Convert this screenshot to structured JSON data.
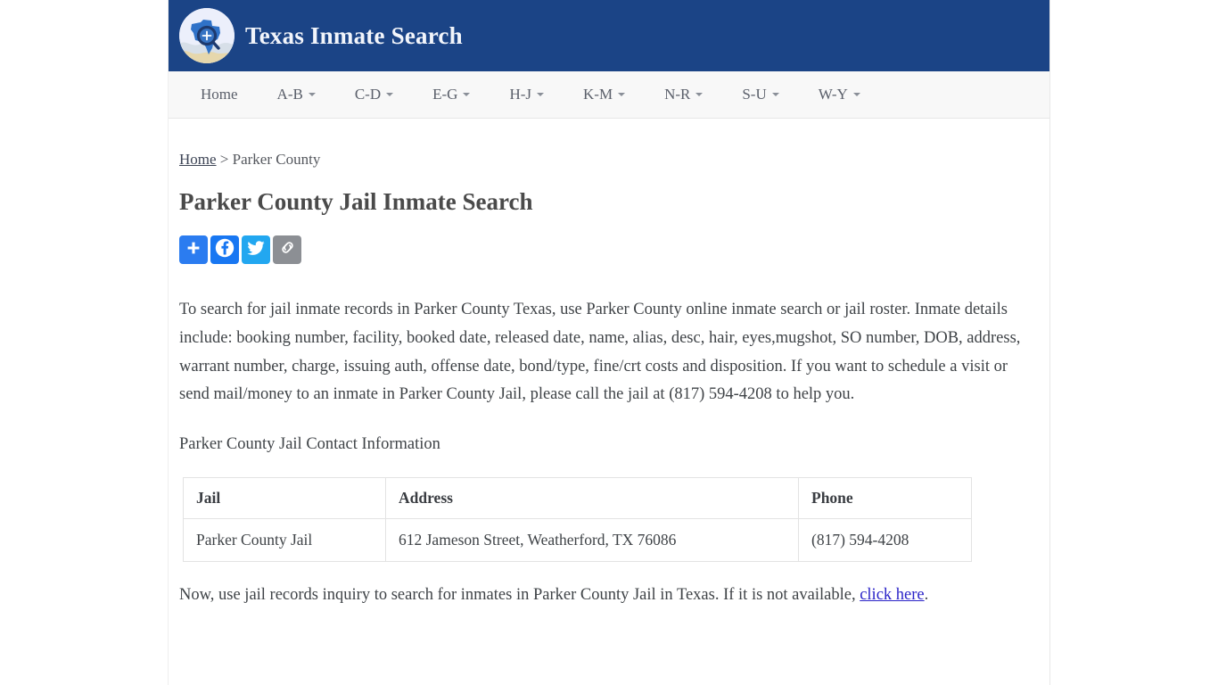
{
  "header": {
    "title": "Texas Inmate Search",
    "logo_icon": "texas-map-magnifier-icon",
    "background_color": "#1b4486"
  },
  "nav": {
    "items": [
      {
        "label": "Home",
        "has_dropdown": false
      },
      {
        "label": "A-B",
        "has_dropdown": true
      },
      {
        "label": "C-D",
        "has_dropdown": true
      },
      {
        "label": "E-G",
        "has_dropdown": true
      },
      {
        "label": "H-J",
        "has_dropdown": true
      },
      {
        "label": "K-M",
        "has_dropdown": true
      },
      {
        "label": "N-R",
        "has_dropdown": true
      },
      {
        "label": "S-U",
        "has_dropdown": true
      },
      {
        "label": "W-Y",
        "has_dropdown": true
      }
    ]
  },
  "breadcrumb": {
    "home_label": "Home",
    "separator": " > ",
    "current": "Parker County"
  },
  "main": {
    "page_title": "Parker County Jail Inmate Search",
    "share_buttons": [
      {
        "name": "addthis",
        "icon": "plus-icon",
        "color": "#2b7cf0"
      },
      {
        "name": "facebook",
        "icon": "facebook-icon",
        "color": "#1877f2"
      },
      {
        "name": "twitter",
        "icon": "twitter-icon",
        "color": "#22a7f0"
      },
      {
        "name": "copy-link",
        "icon": "chain-link-icon",
        "color": "#8c8f94"
      }
    ],
    "intro_paragraph": "To search for jail inmate records in Parker County Texas, use Parker County online inmate search or jail roster. Inmate details include: booking number, facility, booked date, released date, name, alias, desc, hair, eyes,mugshot, SO number, DOB, address, warrant number, charge, issuing auth, offense date, bond/type, fine/crt costs and disposition. If you want to schedule a visit or send mail/money to an inmate in Parker County Jail, please call the jail at (817) 594-4208 to help you.",
    "contact_heading": "Parker County Jail Contact Information",
    "table": {
      "headers": [
        "Jail",
        "Address",
        "Phone"
      ],
      "rows": [
        [
          "Parker County Jail",
          "612 Jameson Street, Weatherford, TX 76086",
          "(817) 594-4208"
        ]
      ]
    },
    "closing_text_before_link": "Now, use jail records inquiry to search for inmates in Parker County Jail in Texas. If it is not available, ",
    "closing_link_label": "click here",
    "closing_text_after_link": "."
  }
}
